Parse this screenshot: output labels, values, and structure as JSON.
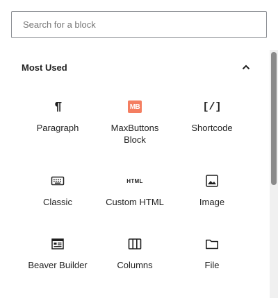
{
  "search": {
    "placeholder": "Search for a block",
    "value": ""
  },
  "section": {
    "title": "Most Used",
    "collapse_icon": "chevron-up-icon"
  },
  "blocks": [
    {
      "label": "Paragraph",
      "icon": "paragraph-icon"
    },
    {
      "label": "MaxButtons Block",
      "icon": "maxbuttons-icon",
      "badge_text": "MB",
      "badge_color": "#f47e61"
    },
    {
      "label": "Shortcode",
      "icon": "shortcode-icon",
      "glyph": "[/]"
    },
    {
      "label": "Classic",
      "icon": "keyboard-icon"
    },
    {
      "label": "Custom HTML",
      "icon": "html-icon",
      "glyph": "HTML"
    },
    {
      "label": "Image",
      "icon": "image-icon"
    },
    {
      "label": "Beaver Builder",
      "icon": "beaver-builder-icon"
    },
    {
      "label": "Columns",
      "icon": "columns-icon"
    },
    {
      "label": "File",
      "icon": "folder-icon"
    }
  ]
}
